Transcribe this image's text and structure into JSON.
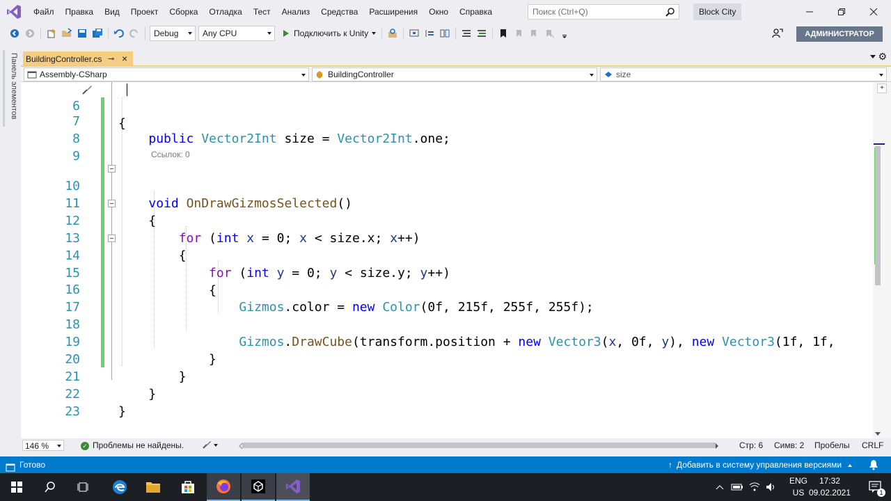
{
  "menu": {
    "items": [
      "Файл",
      "Правка",
      "Вид",
      "Проект",
      "Сборка",
      "Отладка",
      "Тест",
      "Анализ",
      "Средства",
      "Расширения",
      "Окно",
      "Справка"
    ],
    "search_placeholder": "Поиск (Ctrl+Q)",
    "solution_name": "Block City"
  },
  "toolbar": {
    "config": "Debug",
    "platform": "Any CPU",
    "run_label": "Подключить к Unity",
    "admin_label": "АДМИНИСТРАТОР"
  },
  "left_panel": {
    "label": "Панель элементов"
  },
  "document_tab": {
    "title": "BuildingController.cs"
  },
  "navbar": {
    "project": "Assembly-CSharp",
    "type": "BuildingController",
    "member": "size"
  },
  "editor": {
    "codelens": "Ссылок: 0",
    "line_numbers": [
      "6",
      "7",
      "8",
      "9",
      "10",
      "11",
      "12",
      "13",
      "14",
      "15",
      "16",
      "17",
      "18",
      "19",
      "20",
      "21",
      "22",
      "23"
    ]
  },
  "editor_status": {
    "zoom": "146 %",
    "problems": "Проблемы не найдены.",
    "line": "Стр: 6",
    "col": "Симв: 2",
    "insert": "Пробелы",
    "eol": "CRLF"
  },
  "statusbar": {
    "ready": "Готово",
    "source_control": "Добавить в систему управления версиями"
  },
  "taskbar": {
    "lang_top": "ENG",
    "lang_bottom": "US",
    "time": "17:32",
    "date": "09.02.2021",
    "notif_count": "1"
  },
  "colors": {
    "accent_blue": "#007acc",
    "tab_active": "#f5cc84",
    "change_green": "#6fcf6f",
    "keyword": "#0000ff",
    "type": "#2b91af"
  }
}
